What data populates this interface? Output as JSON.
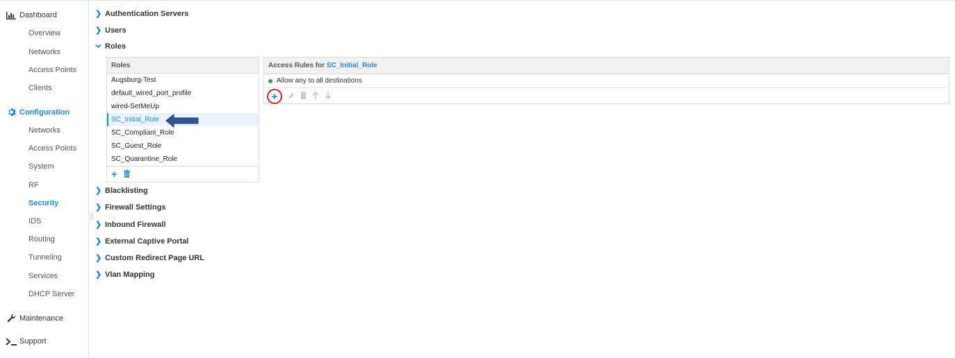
{
  "sidebar": {
    "dashboard": "Dashboard",
    "dashboard_items": [
      "Overview",
      "Networks",
      "Access Points",
      "Clients"
    ],
    "configuration": "Configuration",
    "configuration_items": [
      "Networks",
      "Access Points",
      "System",
      "RF",
      "Security",
      "IDS",
      "Routing",
      "Tunneling",
      "Services",
      "DHCP Server"
    ],
    "active_item": "Security",
    "maintenance": "Maintenance",
    "support": "Support"
  },
  "sections": {
    "authentication_servers": "Authentication Servers",
    "users": "Users",
    "roles": "Roles",
    "blacklisting": "Blacklisting",
    "firewall_settings": "Firewall Settings",
    "inbound_firewall": "Inbound Firewall",
    "external_captive_portal": "External Captive Portal",
    "custom_redirect": "Custom Redirect Page URL",
    "vlan_mapping": "Vlan Mapping"
  },
  "roles_panel": {
    "header": "Roles",
    "items": [
      "Augsburg-Test",
      "default_wired_port_profile",
      "wired-SetMeUp",
      "SC_Initial_Role",
      "SC_Compliant_Role",
      "SC_Guest_Role",
      "SC_Quarantine_Role"
    ],
    "selected": "SC_Initial_Role"
  },
  "rules_panel": {
    "header_prefix": "Access Rules for ",
    "role_name": "SC_Initial_Role",
    "rules": [
      "Allow any to all destinations"
    ]
  },
  "colors": {
    "accent": "#1f8ad6",
    "highlight_circle": "#e02020",
    "arrow": "#2f5597",
    "rule_dot": "#2aa54a"
  }
}
